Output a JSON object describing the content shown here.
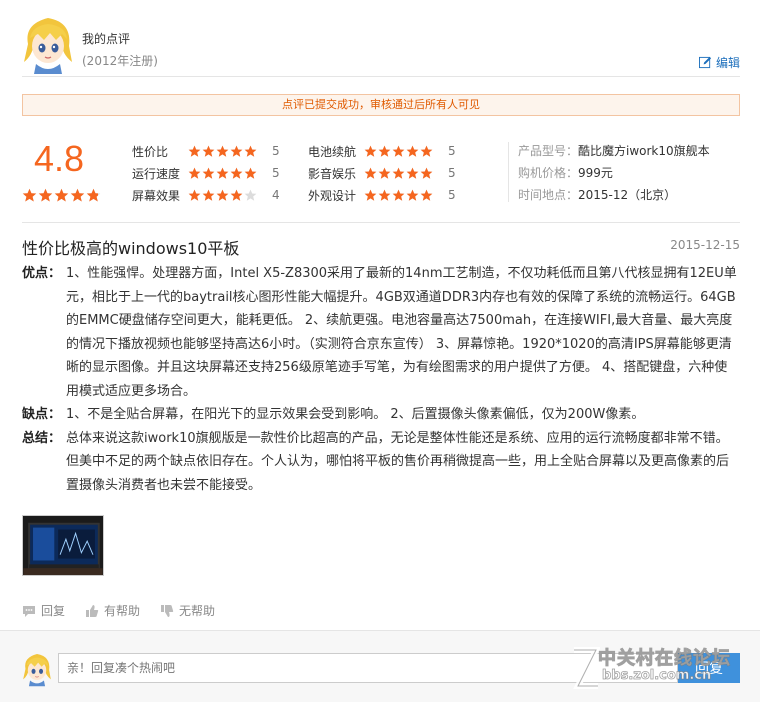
{
  "user": {
    "name": "我的点评",
    "reg_date": "(2012年注册)",
    "edit_label": "编辑"
  },
  "notice": "点评已提交成功，审核通过后所有人可见",
  "score": {
    "overall": "4.8",
    "overall_stars": 4.8
  },
  "ratings": [
    {
      "label": "性价比",
      "value": "5",
      "stars": 5
    },
    {
      "label": "运行速度",
      "value": "5",
      "stars": 5
    },
    {
      "label": "屏幕效果",
      "value": "4",
      "stars": 4
    },
    {
      "label": "电池续航",
      "value": "5",
      "stars": 5
    },
    {
      "label": "影音娱乐",
      "value": "5",
      "stars": 5
    },
    {
      "label": "外观设计",
      "value": "5",
      "stars": 5
    }
  ],
  "info": [
    {
      "label": "产品型号：",
      "value": "酷比魔方iwork10旗舰本"
    },
    {
      "label": "购机价格：",
      "value": "999元"
    },
    {
      "label": "时间地点：",
      "value": "2015-12（北京）"
    }
  ],
  "review": {
    "title": "性价比极高的windows10平板",
    "date": "2015-12-15",
    "pros_label": "优点：",
    "pros": "1、性能强悍。处理器方面，Intel X5-Z8300采用了最新的14nm工艺制造，不仅功耗低而且第八代核显拥有12EU单元，相比于上一代的baytrail核心图形性能大幅提升。4GB双通道DDR3内存也有效的保障了系统的流畅运行。64GB的EMMC硬盘储存空间更大，能耗更低。 2、续航更强。电池容量高达7500mah，在连接WIFI,最大音量、最大亮度的情况下播放视频也能够坚持高达6小时。（实测符合京东宣传） 3、屏幕惊艳。1920*1020的高清IPS屏幕能够更清晰的显示图像。并且这块屏幕还支持256级原笔迹手写笔，为有绘图需求的用户提供了方便。 4、搭配键盘，六种使用模式适应更多场合。",
    "cons_label": "缺点：",
    "cons": "1、不是全贴合屏幕，在阳光下的显示效果会受到影响。 2、后置摄像头像素偏低，仅为200W像素。",
    "summary_label": "总结：",
    "summary": "总体来说这款iwork10旗舰版是一款性价比超高的产品，无论是整体性能还是系统、应用的运行流畅度都非常不错。但美中不足的两个缺点依旧存在。个人认为，哪怕将平板的售价再稍微提高一些，用上全贴合屏幕以及更高像素的后置摄像头消费者也未尝不能接受。"
  },
  "actions": {
    "reply": "回复",
    "helpful": "有帮助",
    "unhelpful": "无帮助"
  },
  "reply_box": {
    "placeholder": "亲！回复凑个热闹吧",
    "button": "回复"
  },
  "watermark": {
    "text": "中关村在线论坛",
    "url": "bbs.zol.com.cn"
  },
  "colors": {
    "accent_orange": "#f5661f",
    "link_blue": "#1d6fbc",
    "button_blue": "#3f91dc"
  }
}
